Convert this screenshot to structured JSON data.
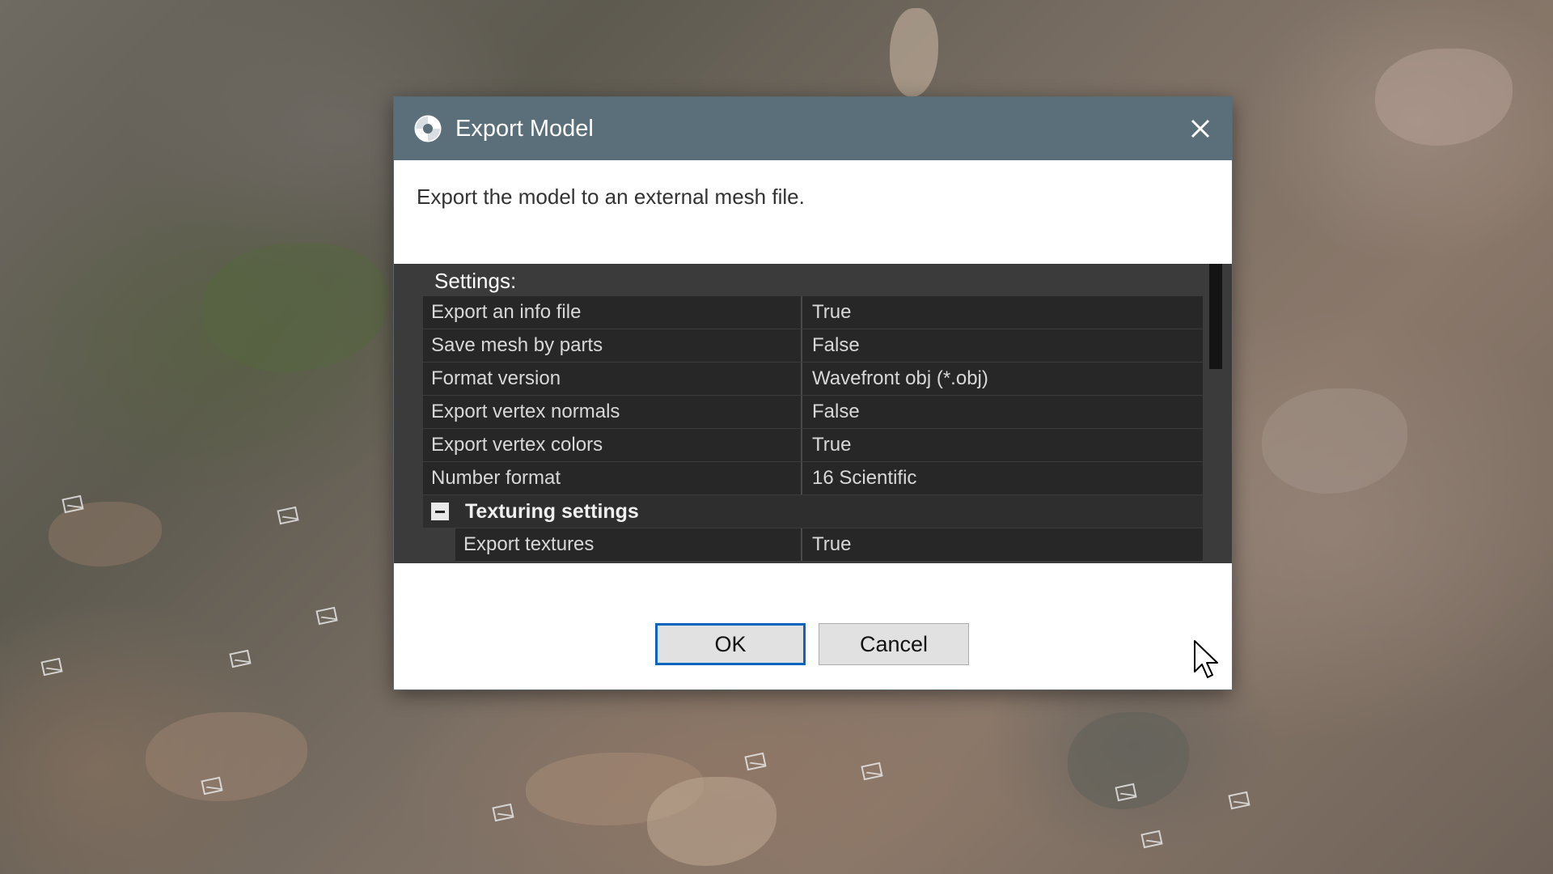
{
  "dialog": {
    "title": "Export Model",
    "description": "Export the model to an external mesh file.",
    "settings_label": "Settings:",
    "properties": [
      {
        "name": "Export an info file",
        "value": "True"
      },
      {
        "name": "Save mesh by parts",
        "value": "False"
      },
      {
        "name": "Format version",
        "value": "Wavefront obj (*.obj)"
      },
      {
        "name": "Export vertex normals",
        "value": "False"
      },
      {
        "name": "Export vertex colors",
        "value": "True"
      },
      {
        "name": "Number format",
        "value": "16 Scientific"
      }
    ],
    "group": {
      "label": "Texturing settings",
      "items": [
        {
          "name": "Export textures",
          "value": "True"
        }
      ]
    },
    "ok_label": "OK",
    "cancel_label": "Cancel"
  },
  "colors": {
    "titlebar": "#5b6f7b",
    "panel_bg": "#3b3b3b",
    "row_bg": "#272727",
    "focus_border": "#0a64c0"
  },
  "icons": {
    "app": "app-logo-icon",
    "close": "close-icon",
    "collapse": "collapse-minus-icon",
    "cursor": "mouse-pointer-icon"
  }
}
